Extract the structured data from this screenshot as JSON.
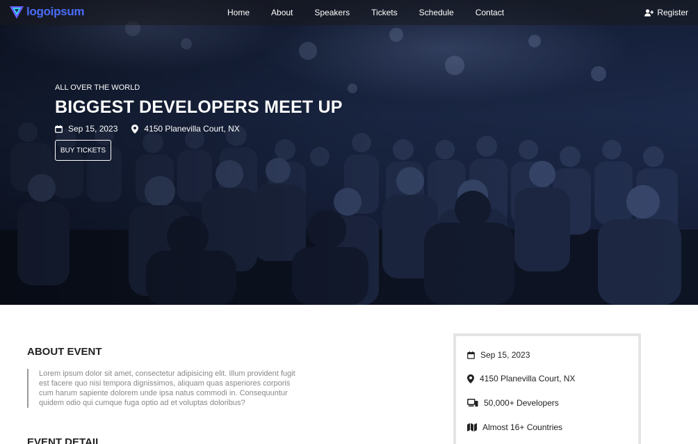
{
  "logo": {
    "text": "logoipsum"
  },
  "nav": {
    "links": [
      "Home",
      "About",
      "Speakers",
      "Tickets",
      "Schedule",
      "Contact"
    ],
    "register_label": "Register"
  },
  "hero": {
    "eyebrow": "ALL OVER THE WORLD",
    "title": "BIGGEST DEVELOPERS MEET UP",
    "date": "Sep 15, 2023",
    "location": "4150 Planevilla Court, NX",
    "cta_label": "BUY TICKETS"
  },
  "about": {
    "title": "ABOUT EVENT",
    "text": "Lorem ipsum dolor sit amet, consectetur adipisicing elit. Illum provident fugit est facere quo nisi tempora dignissimos, aliquam quas asperiores corporis cum harum sapiente dolorem unde ipsa natus commodi in. Consequuntur quidem odio qui cumque fuga optio ad et voluptas doloribus?",
    "detail_title": "EVENT DETAIL"
  },
  "info": {
    "date": "Sep 15, 2023",
    "location": "4150 Planevilla Court, NX",
    "developers": "50,000+ Developers",
    "countries": "Almost 16+ Countries"
  },
  "icons": {
    "calendar": "calendar-icon",
    "pin": "map-pin-icon",
    "devices": "devices-icon",
    "map": "map-icon",
    "user_plus": "user-plus-icon"
  },
  "colors": {
    "brand": "#4a6cf7",
    "hero_bg": "#1d2b4c"
  }
}
